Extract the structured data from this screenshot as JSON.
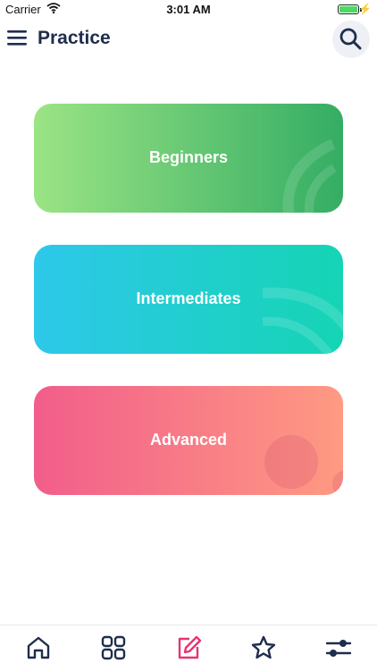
{
  "status_bar": {
    "carrier": "Carrier",
    "time": "3:01 AM"
  },
  "nav": {
    "title": "Practice"
  },
  "levels": [
    {
      "label": "Beginners"
    },
    {
      "label": "Intermediates"
    },
    {
      "label": "Advanced"
    }
  ],
  "tab_bar": {
    "tabs": [
      {
        "icon": "home-icon",
        "active": false
      },
      {
        "icon": "grid-icon",
        "active": false
      },
      {
        "icon": "edit-icon",
        "active": true
      },
      {
        "icon": "star-icon",
        "active": false
      },
      {
        "icon": "sliders-icon",
        "active": false
      }
    ]
  },
  "colors": {
    "primary": "#1f2d4d",
    "active_tab": "#e8336f",
    "beginners_gradient": [
      "#9be484",
      "#34ad64"
    ],
    "intermediates_gradient": [
      "#2ec8ea",
      "#15d4b4"
    ],
    "advanced_gradient": [
      "#f25d8b",
      "#fe9a82"
    ]
  }
}
